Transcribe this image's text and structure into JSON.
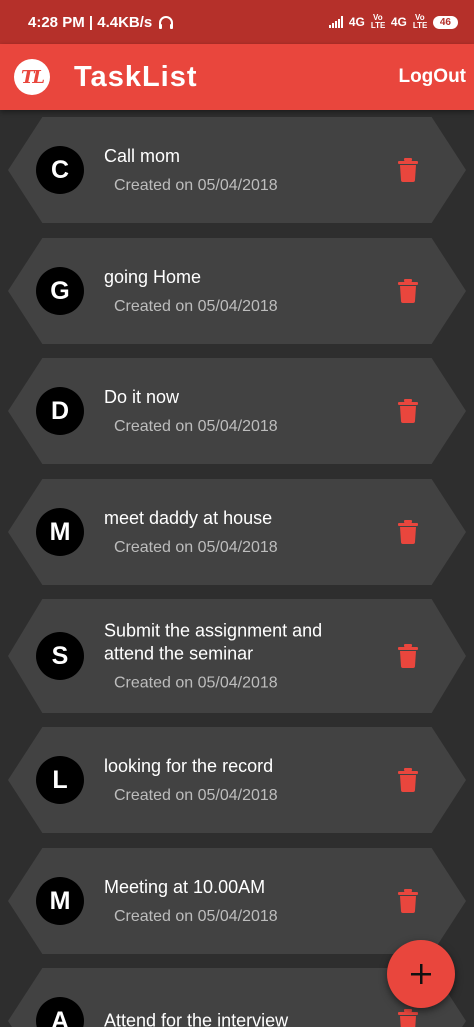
{
  "status_bar": {
    "time_speed": "4:28 PM | 4.4KB/s",
    "network_1": "4G",
    "network_2": "4G",
    "volte_1": "Vo LTE",
    "volte_2": "Vo LTE",
    "battery": "46"
  },
  "app_bar": {
    "logo_text": "TL",
    "title": "TaskList",
    "logout_label": "LogOut",
    "color": "#e9463d"
  },
  "tasks": [
    {
      "initial": "C",
      "title": "Call mom",
      "created": "Created on 05/04/2018"
    },
    {
      "initial": "G",
      "title": "going Home",
      "created": "Created on 05/04/2018"
    },
    {
      "initial": "D",
      "title": "Do it now",
      "created": "Created on 05/04/2018"
    },
    {
      "initial": "M",
      "title": "meet daddy at house",
      "created": "Created on 05/04/2018"
    },
    {
      "initial": "S",
      "title": "Submit the assignment and attend the seminar",
      "created": "Created on 05/04/2018"
    },
    {
      "initial": "L",
      "title": "looking for the record",
      "created": "Created on 05/04/2018"
    },
    {
      "initial": "M",
      "title": "Meeting at 10.00AM",
      "created": "Created on 05/04/2018"
    },
    {
      "initial": "A",
      "title": "Attend for the interview",
      "created": ""
    }
  ],
  "icons": {
    "delete": "trash-icon",
    "add": "plus-icon",
    "headphones": "headphones-icon"
  },
  "colors": {
    "accent": "#e9463d",
    "delete_icon": "#e9463d",
    "card": "#424242",
    "background": "#2e2e2e"
  }
}
